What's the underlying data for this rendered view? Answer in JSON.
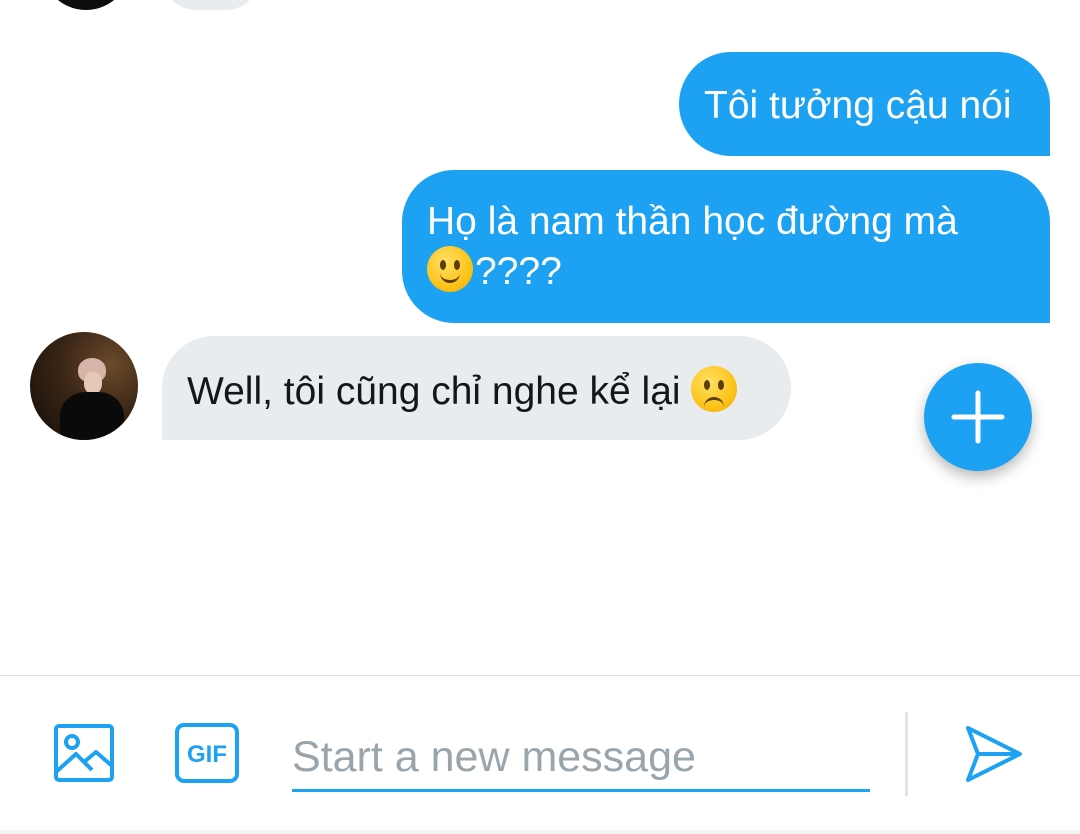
{
  "theme": {
    "accent": "#1da1f2",
    "incoming_bubble": "#e8ecef",
    "outgoing_text": "#ffffff"
  },
  "conversation": {
    "messages": [
      {
        "direction": "outgoing",
        "text": "Tôi tưởng cậu nói"
      },
      {
        "direction": "outgoing",
        "text_line1": "Họ là nam thần học đường mà",
        "emoji": "slightly-smiling-face",
        "suffix": "????"
      },
      {
        "direction": "incoming",
        "text": "Well, tôi cũng chỉ nghe kể lại",
        "emoji": "slightly-frowning-face"
      }
    ]
  },
  "fab": {
    "icon": "plus-icon"
  },
  "compose": {
    "image_icon": "image-icon",
    "gif_label": "GIF",
    "placeholder": "Start a new message",
    "send_icon": "send-icon"
  }
}
